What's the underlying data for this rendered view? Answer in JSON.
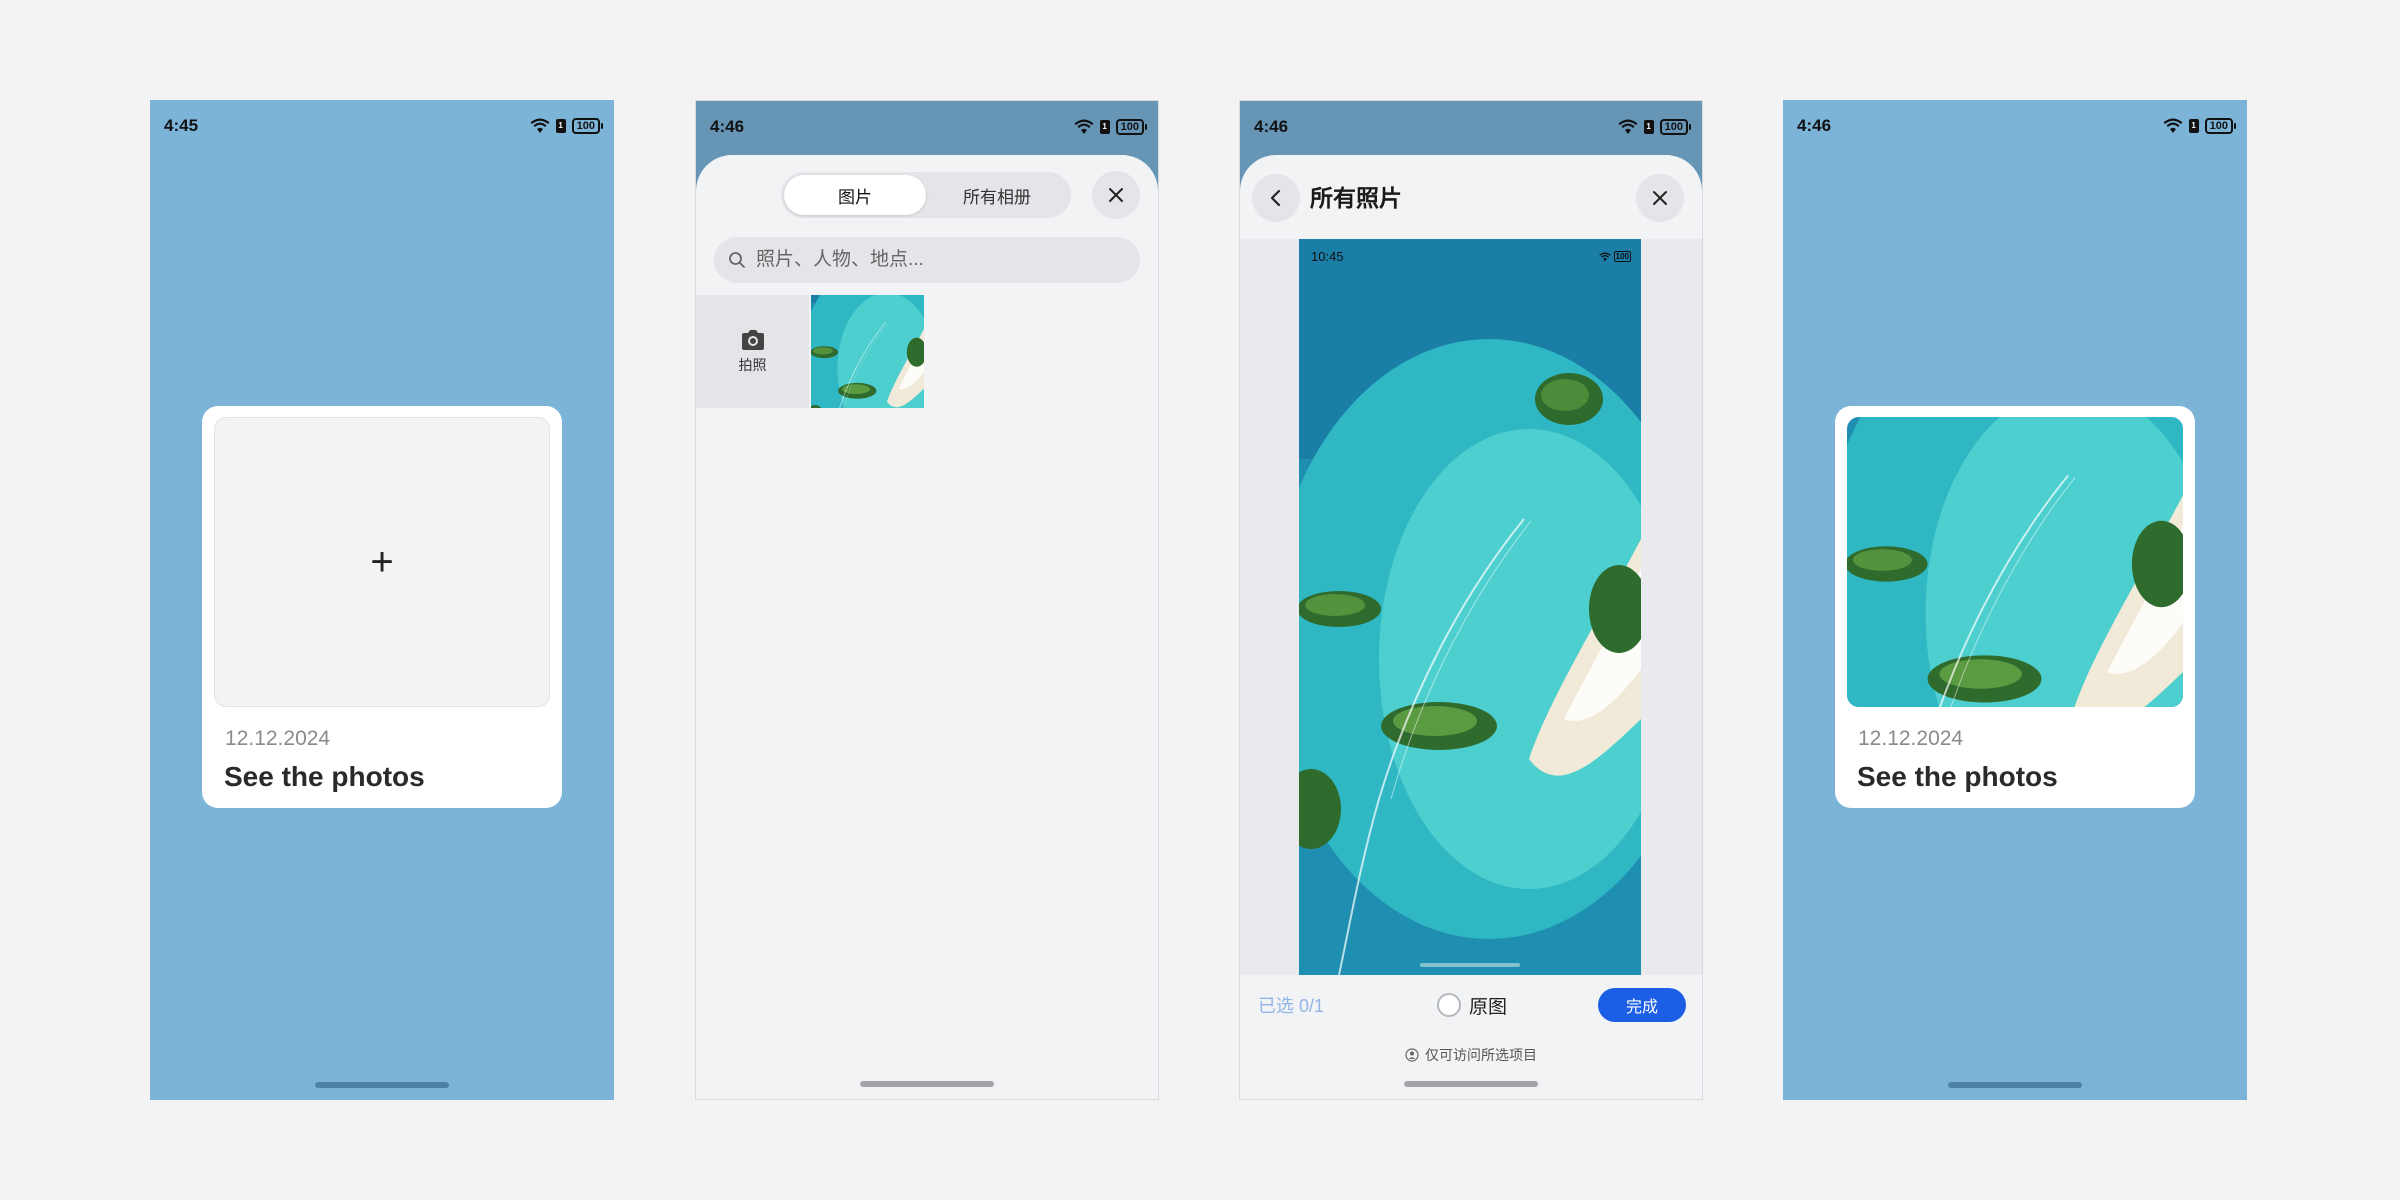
{
  "screen1": {
    "status": {
      "time": "4:45",
      "battery": "100"
    },
    "card": {
      "plus": "+",
      "date": "12.12.2024",
      "title": "See the photos"
    }
  },
  "screen2": {
    "status": {
      "time": "4:46",
      "battery": "100"
    },
    "tabs": [
      {
        "label": "图片",
        "active": true
      },
      {
        "label": "所有相册",
        "active": false
      }
    ],
    "search": {
      "placeholder": "照片、人物、地点..."
    },
    "camera_label": "拍照"
  },
  "screen3": {
    "status": {
      "time": "4:46",
      "battery": "100"
    },
    "title": "所有照片",
    "preview_status": {
      "time": "10:45",
      "battery": "100"
    },
    "selected_count": "已选 0/1",
    "original_label": "原图",
    "done_label": "完成",
    "access_note": "仅可访问所选项目"
  },
  "screen4": {
    "status": {
      "time": "4:46",
      "battery": "100"
    },
    "card": {
      "date": "12.12.2024",
      "title": "See the photos"
    }
  },
  "colors": {
    "app_background": "#7cb4d8",
    "dimmed_background": "#6795b6",
    "accent": "#1c5ee6",
    "page_background": "#f3f3f4"
  }
}
